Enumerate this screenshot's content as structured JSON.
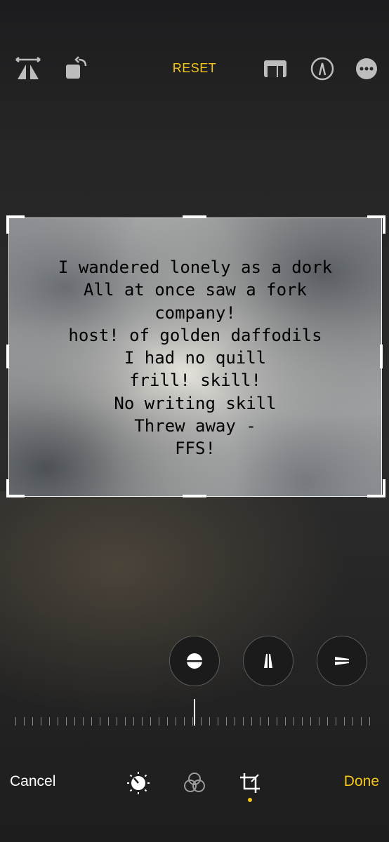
{
  "toolbar": {
    "reset_label": "RESET",
    "icons": [
      "flip-icon",
      "rotate-icon",
      "aspect-ratio-icon",
      "markup-icon",
      "more-icon"
    ]
  },
  "photo": {
    "poem_lines": [
      "I wandered lonely as a dork",
      "All at once saw a fork",
      "company!",
      "host! of golden daffodils",
      "I had no quill",
      "frill! skill!",
      "No writing skill",
      "Threw away -",
      "FFS!"
    ]
  },
  "perspective": {
    "options": [
      "straighten-icon",
      "vertical-perspective-icon",
      "horizontal-perspective-icon"
    ]
  },
  "bottom_bar": {
    "cancel_label": "Cancel",
    "done_label": "Done",
    "modes": [
      "adjust-icon",
      "filters-icon",
      "crop-icon"
    ],
    "active_mode": "crop-icon"
  },
  "colors": {
    "accent": "#f5c518",
    "background": "#262626"
  }
}
